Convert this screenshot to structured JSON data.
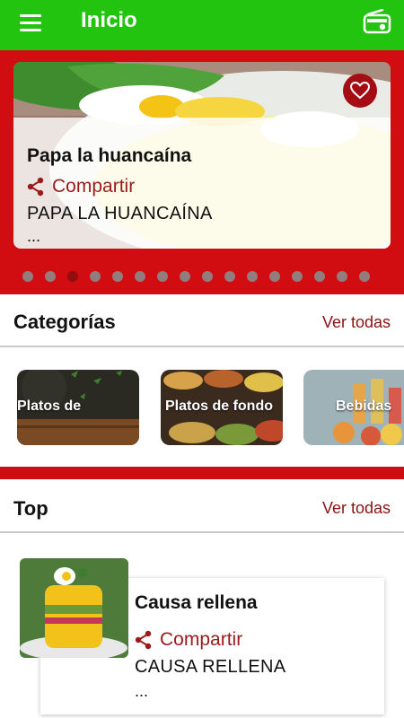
{
  "appbar": {
    "title": "Inicio",
    "menu_icon": "menu-icon",
    "radio_icon": "radio-icon"
  },
  "featured": {
    "title": "Papa la huancaína",
    "share_label": "Compartir",
    "description": "PAPA LA HUANCAÍNA",
    "ellipsis": "...",
    "dots_total": 16,
    "dots_active_index": 2
  },
  "categories": {
    "title": "Categorías",
    "see_all": "Ver todas",
    "items": [
      {
        "label": "Platos de"
      },
      {
        "label": "Platos de fondo"
      },
      {
        "label": "Bebidas"
      }
    ]
  },
  "top": {
    "title": "Top",
    "see_all": "Ver todas",
    "items": [
      {
        "title": "Causa rellena",
        "share_label": "Compartir",
        "description": "CAUSA RELLENA",
        "ellipsis": "..."
      }
    ]
  },
  "colors": {
    "appbar": "#22c40f",
    "accent_red": "#d10d12",
    "link": "#8b1212"
  }
}
